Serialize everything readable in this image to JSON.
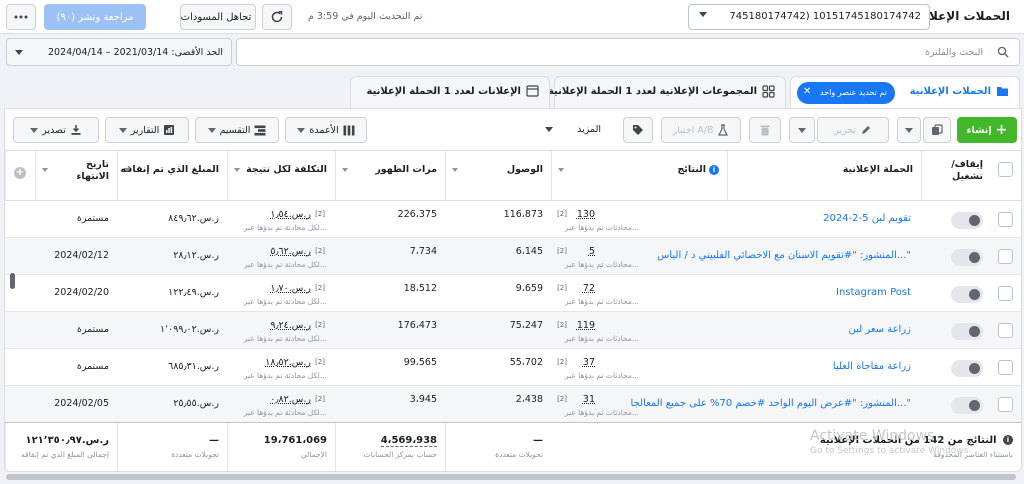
{
  "header": {
    "page_title": "الحملات الإعلانية",
    "account_label": "745180174742) 10151745180174742",
    "last_updated": "تم التحديث اليوم في 3:59 م",
    "discard_drafts": "تجاهل المسودات",
    "review_publish": "مراجعة ونشر (٩٠)"
  },
  "filters": {
    "search_placeholder": "البحث والفلترة",
    "date_range": "الحد الأقصى: 2021/03/14 – 2024/04/14"
  },
  "tabs": {
    "campaigns": "الحملات الإعلانية",
    "selected_chip": "تم تحديد عنصر واحد",
    "adsets": "المجموعات الإعلانية لعدد 1 الحملة الإعلانية",
    "ads": "الإعلانات لعدد 1 الحملة الإعلانية"
  },
  "toolbar": {
    "create": "إنشاء",
    "edit": "تحرير",
    "ab_test": "اختبار A/B",
    "more": "المزيد",
    "columns": "الأعمدة",
    "breakdown": "التقسيم",
    "reports": "التقارير",
    "export": "تصدير"
  },
  "table": {
    "headers": {
      "toggle": "إيقاف/ تشغيل",
      "campaign": "الحملة الإعلانية",
      "results": "النتائج",
      "reach": "الوصول",
      "impressions": "مرات الظهور",
      "cost_per_result": "التكلفة لكل نتيجة",
      "amount_spent": "المبلغ الذي تم إنفاقه",
      "end_date": "تاريخ الانتهاء"
    },
    "result_sub": "محادثات تم بدؤها عبر...",
    "cost_sub": "لكل محادثة تم بدؤها عبر...",
    "rows": [
      {
        "name": "تقويم لبن 5-2-2024",
        "results": "130",
        "reach": "116،873",
        "impressions": "226،375",
        "cost": "ر.س.١٫٥٤",
        "spent": "ر.س.٨٤٩٫٦٢",
        "end": "مستمرة"
      },
      {
        "name": "المنشور: \"#تقويم الاسنان مع الاخصائي الفلبيني د / الياس...\"",
        "results": "5",
        "reach": "6،145",
        "impressions": "7،734",
        "cost": "ر.س.٥٫٦٢",
        "spent": "ر.س.٢٨٫١٢",
        "end": "2024/02/12"
      },
      {
        "name": "Instagram Post",
        "results": "72",
        "reach": "9،659",
        "impressions": "18،512",
        "cost": "ر.س.١٫٧٠",
        "spent": "ر.س.١٢٢٫٤٩",
        "end": "2024/02/20"
      },
      {
        "name": "زراعة سعر لبن",
        "results": "119",
        "reach": "75،247",
        "impressions": "176،473",
        "cost": "ر.س.٩٫٢٤",
        "spent": "ر.س.١٬٠٩٩٫٠٢",
        "end": "مستمرة"
      },
      {
        "name": "زراعة مفاجاة العليا",
        "results": "37",
        "reach": "55،702",
        "impressions": "99،565",
        "cost": "ر.س.١٨٫٥٢",
        "spent": "ر.س.٦٨٥٫٣١",
        "end": "مستمرة"
      },
      {
        "name": "المنشور: \"#عرض اليوم الواحد #خصم 70% على جميع المعالجا...\"",
        "results": "31",
        "reach": "2،438",
        "impressions": "3،945",
        "cost": "ر.س.٠٫٨٢",
        "spent": "ر.س.٢٥٫٥٥",
        "end": "2024/02/05"
      }
    ],
    "totals": {
      "label": "النتائج من 142 من الحملات الإعلانية",
      "label_sub": "باستثناء العناصر المحذوفة",
      "results": "—",
      "results_sub": "تحويلات متعددة",
      "reach": "4،569،938",
      "reach_sub": "حساب بمركز الحسابات",
      "impressions": "19،761،069",
      "impressions_sub": "الإجمالي",
      "cost": "—",
      "cost_sub": "تحويلات متعددة",
      "spent": "ر.س.١٢١٬٣٥٠٫٩٧",
      "spent_sub": "إجمالي المبلغ الذي تم إنفاقه"
    }
  },
  "watermark": {
    "title": "Activate Windows",
    "subtitle": "Go to Settings to activate Windows."
  }
}
